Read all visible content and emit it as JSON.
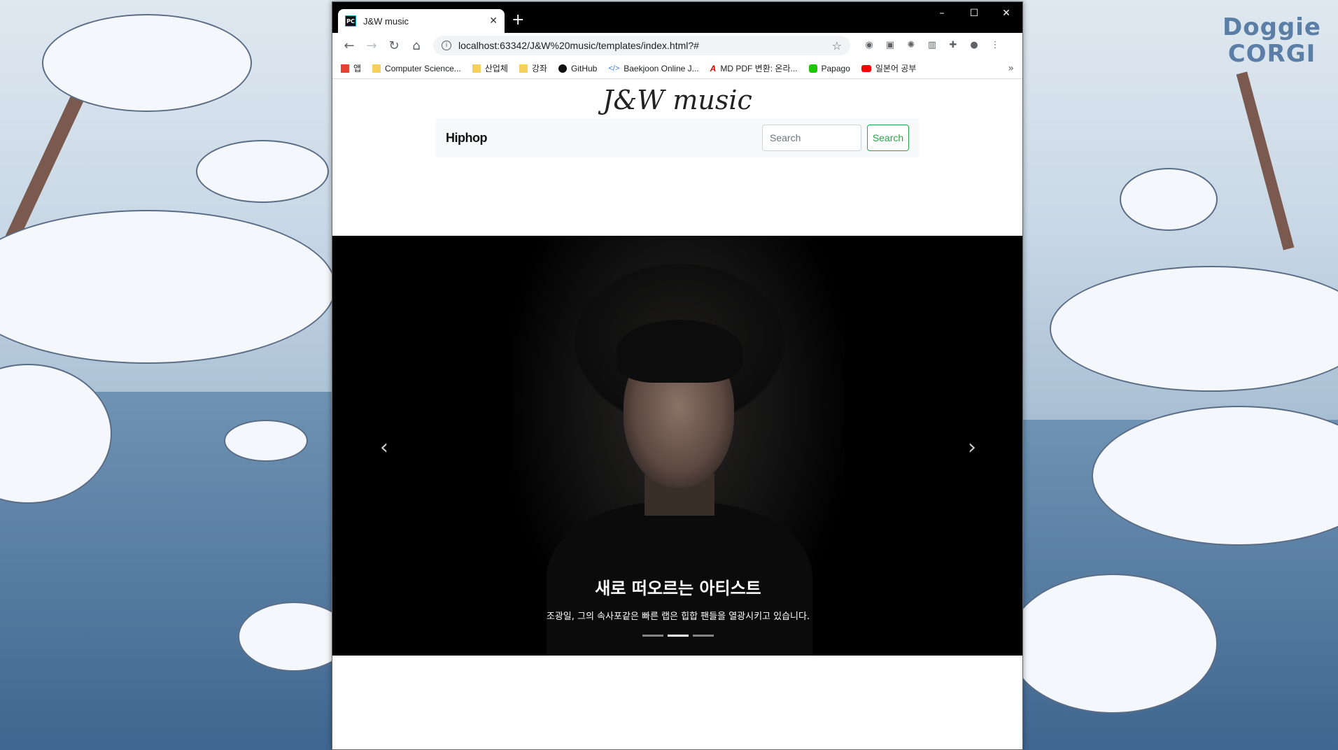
{
  "wallpaper": {
    "watermark": "Doggie\nCORGI"
  },
  "browser": {
    "tab_title": "J&W music",
    "url": "localhost:63342/J&W%20music/templates/index.html?#",
    "bookmarks": [
      {
        "label": "앱",
        "icon": "apps-grid-icon"
      },
      {
        "label": "Computer Science...",
        "icon": "folder-icon"
      },
      {
        "label": "산업체",
        "icon": "folder-icon"
      },
      {
        "label": "강좌",
        "icon": "folder-icon"
      },
      {
        "label": "GitHub",
        "icon": "github-icon"
      },
      {
        "label": "Baekjoon Online J...",
        "icon": "code-icon"
      },
      {
        "label": "MD PDF 변환: 온라...",
        "icon": "pdf-icon"
      },
      {
        "label": "Papago",
        "icon": "papago-icon"
      },
      {
        "label": "일본어 공부",
        "icon": "youtube-icon"
      }
    ]
  },
  "page": {
    "brand": "J&W music",
    "navbar": {
      "brand": "Hiphop",
      "search_placeholder": "Search",
      "search_button": "Search"
    },
    "carousel": {
      "caption_title": "새로 떠오르는 아티스트",
      "caption_text": "조광일, 그의 속사포같은 빠른 랩은 힙합 팬들을 열광시키고 있습니다.",
      "slide_count": 3,
      "active_index": 1
    }
  },
  "colors": {
    "accent_green": "#28a745",
    "carousel_bg": "#000000"
  }
}
